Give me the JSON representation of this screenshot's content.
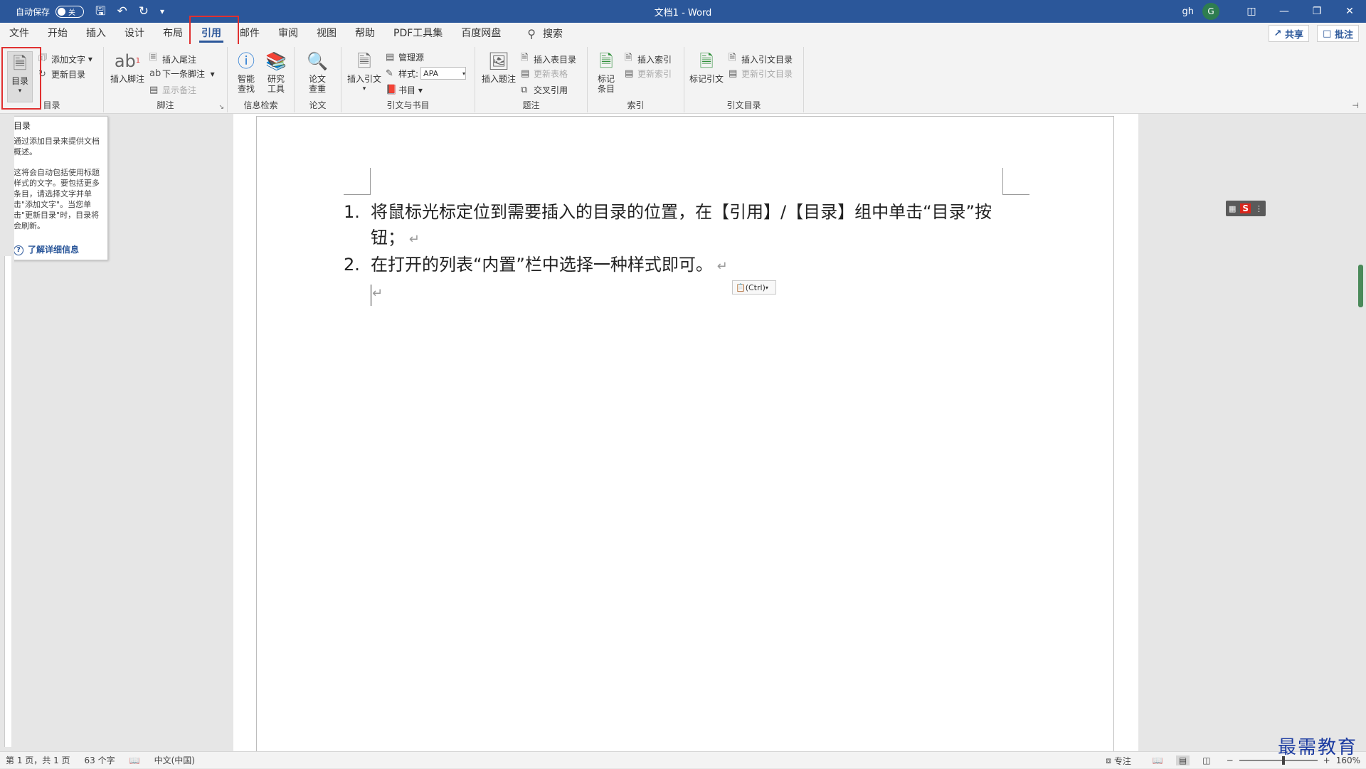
{
  "title_bar": {
    "autosave_label": "自动保存",
    "autosave_state": "关",
    "doc_title": "文档1 - Word",
    "user_name": "gh",
    "avatar_initial": "G",
    "accent": "#2b579a"
  },
  "tabs": [
    "文件",
    "开始",
    "插入",
    "设计",
    "布局",
    "引用",
    "邮件",
    "审阅",
    "视图",
    "帮助",
    "PDF工具集",
    "百度网盘"
  ],
  "active_tab": "引用",
  "search_label": "搜索",
  "share_label": "共享",
  "comment_label": "批注",
  "ribbon": {
    "toc": {
      "toc_button": "目录",
      "add_text": "添加文字",
      "update_toc": "更新目录",
      "group": "目录"
    },
    "footnotes": {
      "insert_footnote": "插入脚注",
      "insert_endnote": "插入尾注",
      "next_footnote": "下一条脚注",
      "show_notes": "显示备注",
      "group": "脚注"
    },
    "research": {
      "smart_lookup": "智能查找",
      "researcher": "研究工具",
      "group": "信息检索"
    },
    "paper": {
      "check": "论文查重",
      "group": "论文"
    },
    "citations": {
      "insert_citation": "插入引文",
      "manage_sources": "管理源",
      "style_label": "样式:",
      "style_value": "APA",
      "bibliography": "书目",
      "group": "引文与书目"
    },
    "captions": {
      "insert_caption": "插入题注",
      "insert_table_figures": "插入表目录",
      "update_table": "更新表格",
      "cross_reference": "交叉引用",
      "group": "题注"
    },
    "index": {
      "mark_entry": "标记条目",
      "insert_index": "插入索引",
      "update_index": "更新索引",
      "group": "索引"
    },
    "authorities": {
      "mark_citation": "标记引文",
      "insert_toa": "插入引文目录",
      "update_toa": "更新引文目录",
      "group": "引文目录"
    }
  },
  "tooltip": {
    "title": "目录",
    "desc1": "通过添加目录来提供文档概述。",
    "desc2": "这将会自动包括使用标题样式的文字。要包括更多条目，请选择文字并单击\"添加文字\"。当您单击\"更新目录\"时，目录将会刷新。",
    "link": "了解详细信息"
  },
  "document": {
    "items": [
      {
        "num": "1.",
        "text": "将鼠标光标定位到需要插入的目录的位置，在【引用】/【目录】组中单击“目录”按钮；"
      },
      {
        "num": "2.",
        "text": "在打开的列表“内置”栏中选择一种样式即可。"
      }
    ],
    "paste_options": "(Ctrl)"
  },
  "status": {
    "page": "第 1 页，共 1 页",
    "words": "63 个字",
    "language": "中文(中国)",
    "focus": "专注",
    "zoom": "160%"
  },
  "watermark": "最需教育"
}
